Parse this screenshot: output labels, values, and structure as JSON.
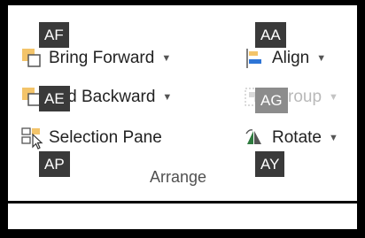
{
  "ribbon": {
    "group_label": "Arrange",
    "commands": {
      "bring_forward": "Bring Forward",
      "send_backward": "Send Backward",
      "selection_pane": "Selection Pane",
      "align": "Align",
      "group": "Group",
      "rotate": "Rotate"
    },
    "send_backward_visible": "end Backward",
    "group_visible": "roup",
    "keytips": {
      "bring_forward": "AF",
      "send_backward": "AE",
      "selection_pane": "AP",
      "align": "AA",
      "group": "AG",
      "rotate": "AY"
    }
  },
  "colors": {
    "keytip_bg": "#3a3a3a",
    "accent_orange": "#f3c46a",
    "align_blue": "#2e75d6"
  }
}
